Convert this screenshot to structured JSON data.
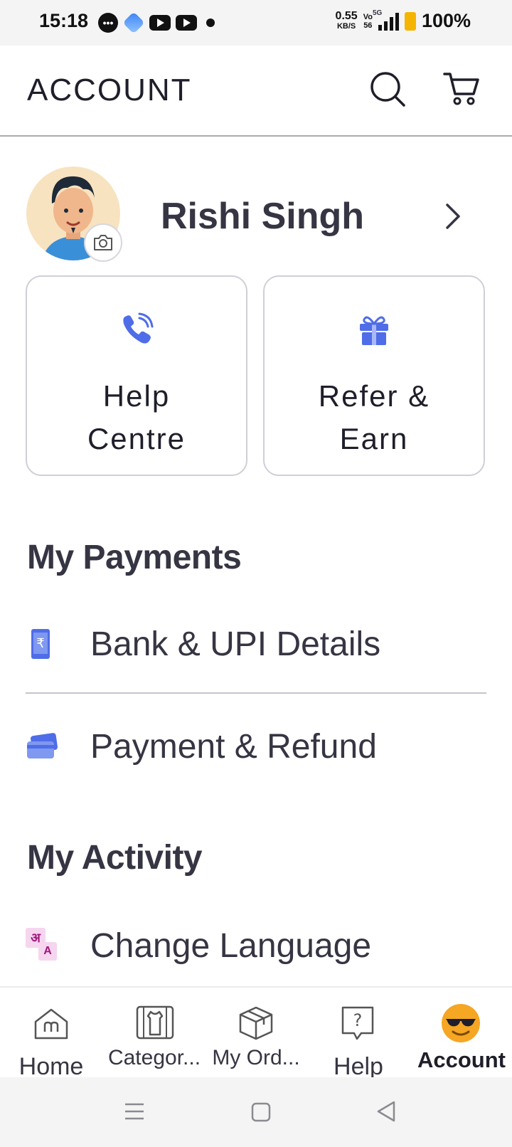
{
  "status_bar": {
    "time": "15:18",
    "net_speed_value": "0.55",
    "net_speed_unit": "KB/S",
    "volte_top": "Vo",
    "volte_bottom": "56",
    "network": "5G",
    "battery": "100%"
  },
  "header": {
    "title": "ACCOUNT",
    "icons": [
      "search-icon",
      "cart-icon"
    ]
  },
  "profile": {
    "name": "Rishi Singh"
  },
  "cards": [
    {
      "line1": "Help",
      "line2": "Centre",
      "icon": "phone-call-icon"
    },
    {
      "line1": "Refer &",
      "line2": "Earn",
      "icon": "gift-icon"
    }
  ],
  "payments": {
    "title": "My Payments",
    "items": [
      {
        "label": "Bank & UPI Details",
        "icon": "rupee-phone-icon"
      },
      {
        "label": "Payment & Refund",
        "icon": "cards-icon"
      }
    ]
  },
  "activity": {
    "title": "My Activity",
    "items": [
      {
        "label": "Change Language",
        "icon": "language-icon",
        "icon_glyph_1": "अ",
        "icon_glyph_2": "A"
      }
    ]
  },
  "bottom_nav": [
    {
      "label": "Home",
      "icon": "home-icon"
    },
    {
      "label": "Categor...",
      "icon": "categories-icon"
    },
    {
      "label": "My Ord...",
      "icon": "box-icon"
    },
    {
      "label": "Help",
      "icon": "help-icon"
    },
    {
      "label": "Account",
      "icon": "smiley-sunglasses-icon",
      "active": true
    }
  ],
  "colors": {
    "accent_blue": "#4f6de8",
    "text_dark": "#353543",
    "active_emoji": "#f5a623"
  }
}
